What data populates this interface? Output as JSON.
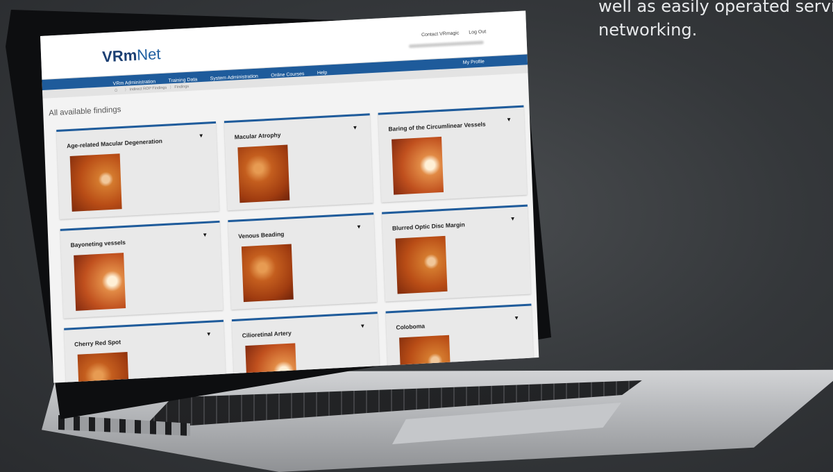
{
  "marketing_text": {
    "lines": [
      "well as easily operated service",
      "networking."
    ]
  },
  "app": {
    "logo_bold": "VRm",
    "logo_rest": "Net",
    "top_links": {
      "contact": "Contact VRmagic",
      "logout": "Log Out"
    },
    "nav": {
      "items": [
        "VRm Administration",
        "Training Data",
        "System Administration",
        "Online Courses",
        "Help"
      ],
      "profile": "My Profile"
    },
    "breadcrumb": {
      "items": [
        "Indirect ROP Findings",
        "Findings"
      ]
    },
    "page_title": "All available findings",
    "findings": [
      {
        "name": "Age-related Macular Degeneration"
      },
      {
        "name": "Macular Atrophy"
      },
      {
        "name": "Baring of the Circumlinear Vessels"
      },
      {
        "name": "Bayoneting vessels"
      },
      {
        "name": "Venous Beading"
      },
      {
        "name": "Blurred Optic Disc Margin"
      },
      {
        "name": "Cherry Red Spot"
      },
      {
        "name": "Cilioretinal Artery"
      },
      {
        "name": "Coloboma"
      }
    ]
  },
  "colors": {
    "nav_blue": "#1e5b9b",
    "logo_dark": "#1b3f73",
    "card_bg": "#e9e9e9"
  },
  "icons": {
    "home": "home-icon",
    "expand": "dropdown-triangle-icon"
  }
}
